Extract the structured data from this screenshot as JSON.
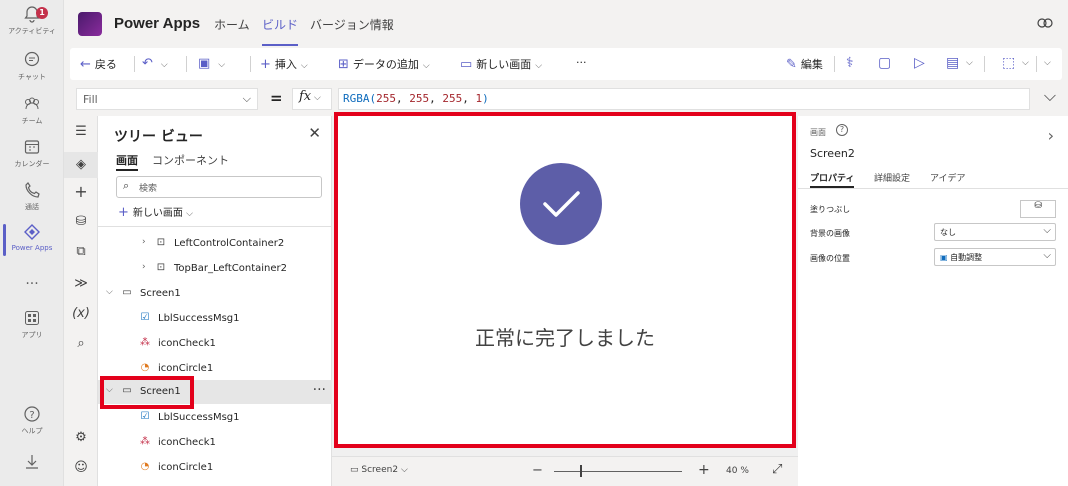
{
  "rail": {
    "items": [
      {
        "label": "アクティビティ",
        "icon": "bell-icon",
        "badge": "1"
      },
      {
        "label": "チャット",
        "icon": "chat-icon"
      },
      {
        "label": "チーム",
        "icon": "teams-icon"
      },
      {
        "label": "カレンダー",
        "icon": "calendar-icon"
      },
      {
        "label": "通話",
        "icon": "phone-icon"
      },
      {
        "label": "Power Apps",
        "icon": "powerapps-icon"
      },
      {
        "label": "...",
        "icon": "more-icon"
      },
      {
        "label": "アプリ",
        "icon": "apps-icon"
      },
      {
        "label": "ヘルプ",
        "icon": "help-icon"
      }
    ]
  },
  "header": {
    "app_name": "Power Apps",
    "tabs": [
      "ホーム",
      "ビルド",
      "バージョン情報"
    ],
    "active_tab": "ビルド"
  },
  "toolbar": {
    "back": "戻る",
    "insert": "挿入",
    "add_data": "データの追加",
    "new_screen": "新しい画面",
    "edit": "編集"
  },
  "formula_bar": {
    "property": "Fill",
    "equals": "=",
    "fx": "fx",
    "fn": "RGBA(",
    "args": [
      "255",
      "255",
      "255",
      "1"
    ],
    "close": ")"
  },
  "tree": {
    "title": "ツリー ビュー",
    "tabs": [
      "画面",
      "コンポーネント"
    ],
    "search_placeholder": "検索",
    "new_screen": "新しい画面",
    "items": [
      {
        "label": "LeftControlContainer2"
      },
      {
        "label": "TopBar_LeftContainer2"
      },
      {
        "label": "Screen1"
      },
      {
        "label": "LblSuccessMsg1"
      },
      {
        "label": "iconCheck1"
      },
      {
        "label": "iconCircle1"
      },
      {
        "label": "Screen1"
      },
      {
        "label": "LblSuccessMsg1"
      },
      {
        "label": "iconCheck1"
      },
      {
        "label": "iconCircle1"
      }
    ]
  },
  "canvas": {
    "message": "正常に完了しました",
    "accent": "#5d5ea8"
  },
  "status_bar": {
    "screen": "Screen2",
    "zoom_value": "40",
    "zoom_unit": "%",
    "zoom_level_fraction": 0.2
  },
  "properties": {
    "kind": "画面",
    "name": "Screen2",
    "tabs": [
      "プロパティ",
      "詳細設定",
      "アイデア"
    ],
    "fill_label": "塗りつぶし",
    "bg_image_label": "背景の画像",
    "bg_image_value": "なし",
    "image_pos_label": "画像の位置",
    "image_pos_value": "自動調整"
  },
  "colors": {
    "brand": "#5b5fc7",
    "highlight": "#e3001b"
  }
}
